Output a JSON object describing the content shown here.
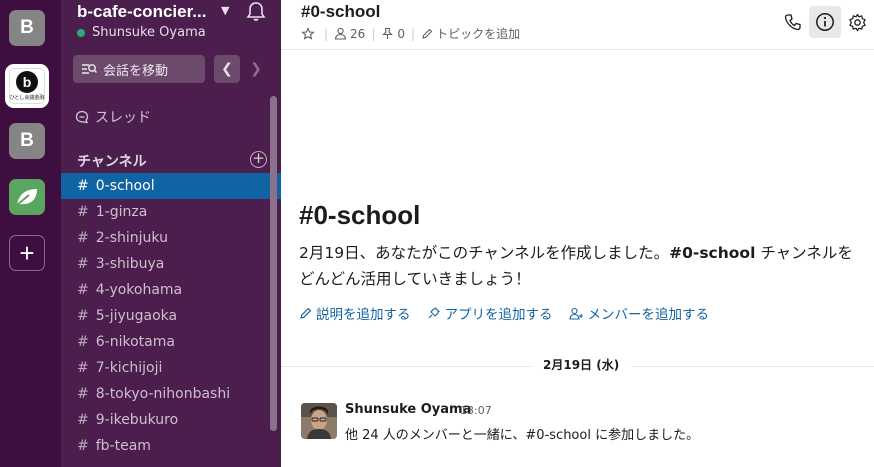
{
  "workspaces": [
    {
      "label": "B",
      "color": "#858585"
    },
    {
      "label": "b",
      "sublabel": "ひとし会議金融"
    },
    {
      "label": "B",
      "color": "#858585"
    },
    {
      "label": "",
      "icon": "leaf-icon",
      "color": "#5aa661"
    },
    {
      "label": "+"
    }
  ],
  "sidebar": {
    "team_name": "b-cafe-concier...",
    "user_name": "Shunsuke Oyama",
    "jump_label": "会話を移動",
    "threads_label": "スレッド",
    "section_title": "チャンネル",
    "selected_channel": "0-school",
    "channels": [
      "0-school",
      "1-ginza",
      "2-shinjuku",
      "3-shibuya",
      "4-yokohama",
      "5-jiyugaoka",
      "6-nikotama",
      "7-kichijoji",
      "8-tokyo-nihonbashi",
      "9-ikebukuro",
      "fb-team"
    ]
  },
  "header": {
    "title": "#0-school",
    "member_count": "26",
    "pinned_count": "0",
    "add_topic": "トピックを追加"
  },
  "intro": {
    "title": "#0-school",
    "text_before": "2月19日、あなたがこのチャンネルを作成しました。",
    "text_bold": "#0-school",
    "text_after": " チャンネルをどんどん活用していきましょう！",
    "actions": [
      "説明を追加する",
      "アプリを追加する",
      "メンバーを追加する"
    ]
  },
  "date_divider": "2月19日 (水)",
  "message": {
    "author": "Shunsuke Oyama",
    "time": "13:07",
    "body": "他 24 人のメンバーと一緒に、#0-school に参加しました。"
  },
  "colors": {
    "rail": "#3f0e40",
    "sidebar": "#4c1e4d",
    "selected": "#1164a3",
    "link": "#1264a3",
    "presence": "#2bac76"
  }
}
